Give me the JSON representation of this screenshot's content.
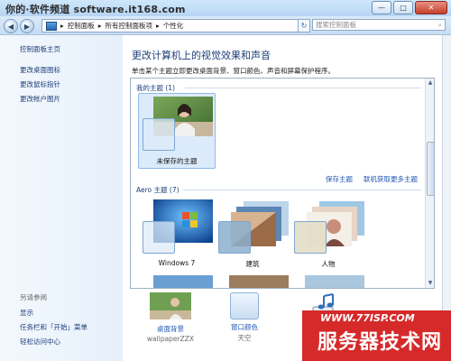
{
  "watermark_top": "你的·软件频道 software.it168.com",
  "window_controls": {
    "min": "—",
    "max": "□",
    "close": "✕"
  },
  "nav": {
    "back": "◀",
    "forward": "▶",
    "breadcrumb": [
      "控制面板",
      "所有控制面板项",
      "个性化"
    ],
    "separator": "▸",
    "refresh": "↻",
    "search_placeholder": "搜索控制面板",
    "search_icon": "⌕"
  },
  "sidebar": {
    "items": [
      "控制面板主页",
      "更改桌面图标",
      "更改鼠标指针",
      "更改帐户图片"
    ],
    "see_also_title": "另请参阅",
    "see_also": [
      "显示",
      "任务栏和「开始」菜单",
      "轻松访问中心"
    ]
  },
  "main": {
    "title": "更改计算机上的视觉效果和声音",
    "subtitle": "单击某个主题立即更改桌面背景、窗口颜色、声音和屏幕保护程序。",
    "my_themes_header": "我的主题 (1)",
    "my_themes": [
      {
        "name": "未保存的主题"
      }
    ],
    "save_theme": "保存主题",
    "get_more": "联机获取更多主题",
    "aero_header": "Aero 主题 (7)",
    "aero_themes": [
      {
        "name": "Windows 7"
      },
      {
        "name": "建筑"
      },
      {
        "name": "人物"
      }
    ]
  },
  "bottom": [
    {
      "label": "桌面背景",
      "sub": "wallpaperZZX",
      "icon": "wallpaper-icon"
    },
    {
      "label": "窗口颜色",
      "sub": "天空",
      "icon": "window-color-icon"
    },
    {
      "label": "",
      "sub": "",
      "icon": "sound-icon"
    }
  ],
  "watermark_bottom": {
    "url": "WWW.77ISP.COM",
    "name": "服务器技术网"
  },
  "colors": {
    "link": "#1f56b3",
    "heading": "#1e3f7a",
    "selected": "#dcebfb",
    "watermark_red": "#d62a2a"
  }
}
